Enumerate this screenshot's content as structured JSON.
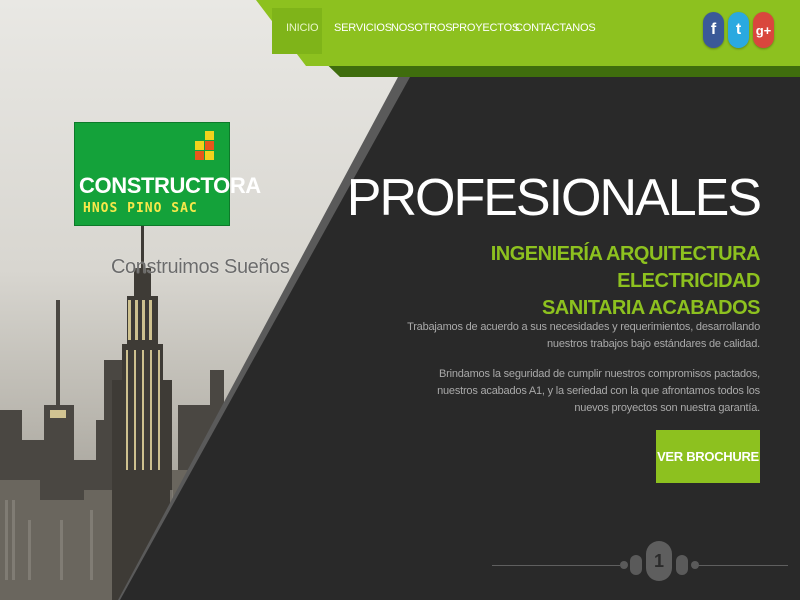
{
  "nav": {
    "items": [
      "INICIO",
      "SERVICIOS",
      "NOSOTROS",
      "PROYECTOS",
      "CONTACTANOS"
    ],
    "active_index": 0
  },
  "social": [
    {
      "name": "facebook-icon",
      "glyph": "f",
      "color": "#3b5998"
    },
    {
      "name": "twitter-icon",
      "glyph": "t",
      "color": "#2aa9e0"
    },
    {
      "name": "google-plus-icon",
      "glyph": "g+",
      "color": "#d9473d"
    }
  ],
  "logo": {
    "title": "CONSTRUCTORA",
    "subtitle": "HNOS PINO SAC"
  },
  "tagline": "Construimos Sueños",
  "hero": {
    "title": "PROFESIONALES",
    "subtitle_line1": "INGENIERÍA ARQUITECTURA ELECTRICIDAD",
    "subtitle_line2": "SANITARIA ACABADOS",
    "paragraph1": "Trabajamos de acuerdo a sus necesidades y requerimientos, desarrollando nuestros trabajos bajo estándares de calidad.",
    "paragraph2": "Brindamos la seguridad de cumplir nuestros compromisos pactados, nuestros acabados A1, y la seriedad con la que afrontamos todos los nuevos proyectos son nuestra garantía.",
    "button_label": "VER BROCHURE"
  },
  "pager": {
    "current": "1"
  },
  "colors": {
    "accent": "#8dc11f",
    "accent_dark": "#3f6d0d",
    "panel": "#292929"
  }
}
